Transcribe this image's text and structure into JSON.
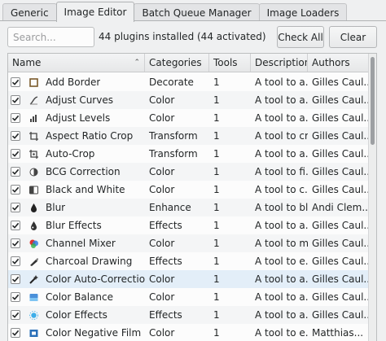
{
  "tabs": [
    {
      "label": "Generic"
    },
    {
      "label": "Image Editor"
    },
    {
      "label": "Batch Queue Manager"
    },
    {
      "label": "Image Loaders"
    }
  ],
  "active_tab": "Image Editor",
  "toolbar": {
    "search_placeholder": "Search...",
    "installed_text": "44 plugins installed (44 activated)",
    "check_all_label": "Check All",
    "clear_label": "Clear"
  },
  "table": {
    "columns": [
      "Name",
      "Categories",
      "Tools",
      "Description",
      "Authors"
    ],
    "sorted_column": "Name",
    "rows": [
      {
        "checked": true,
        "icon": "border-icon",
        "name": "Add Border",
        "category": "Decorate",
        "tools": "1",
        "description": "A tool to a...",
        "authors": "Gilles Caul..."
      },
      {
        "checked": true,
        "icon": "curves-icon",
        "name": "Adjust Curves",
        "category": "Color",
        "tools": "1",
        "description": "A tool to a...",
        "authors": "Gilles Caul..."
      },
      {
        "checked": true,
        "icon": "levels-icon",
        "name": "Adjust Levels",
        "category": "Color",
        "tools": "1",
        "description": "A tool to a...",
        "authors": "Gilles Caul..."
      },
      {
        "checked": true,
        "icon": "ratio-crop-icon",
        "name": "Aspect Ratio Crop",
        "category": "Transform",
        "tools": "1",
        "description": "A tool to cr...",
        "authors": "Gilles Caul..."
      },
      {
        "checked": true,
        "icon": "auto-crop-icon",
        "name": "Auto-Crop",
        "category": "Transform",
        "tools": "1",
        "description": "A tool to a...",
        "authors": "Gilles Caul..."
      },
      {
        "checked": true,
        "icon": "bcg-icon",
        "name": "BCG Correction",
        "category": "Color",
        "tools": "1",
        "description": "A tool to fi...",
        "authors": "Gilles Caul..."
      },
      {
        "checked": true,
        "icon": "black-white-icon",
        "name": "Black and White",
        "category": "Color",
        "tools": "1",
        "description": "A tool to c...",
        "authors": "Gilles Caul..."
      },
      {
        "checked": true,
        "icon": "blur-icon",
        "name": "Blur",
        "category": "Enhance",
        "tools": "1",
        "description": "A tool to bl...",
        "authors": "Andi Clem..."
      },
      {
        "checked": true,
        "icon": "blur-effects-icon",
        "name": "Blur Effects",
        "category": "Effects",
        "tools": "1",
        "description": "A tool to a...",
        "authors": "Gilles Caul..."
      },
      {
        "checked": true,
        "icon": "channel-mixer-icon",
        "name": "Channel Mixer",
        "category": "Color",
        "tools": "1",
        "description": "A tool to m...",
        "authors": "Gilles Caul..."
      },
      {
        "checked": true,
        "icon": "charcoal-icon",
        "name": "Charcoal Drawing",
        "category": "Effects",
        "tools": "1",
        "description": "A tool to e...",
        "authors": "Gilles Caul..."
      },
      {
        "checked": true,
        "icon": "auto-correction-icon",
        "name": "Color Auto-Correction",
        "category": "Color",
        "tools": "1",
        "description": "A tool to a...",
        "authors": "Gilles Caul..."
      },
      {
        "checked": true,
        "icon": "color-balance-icon",
        "name": "Color Balance",
        "category": "Color",
        "tools": "1",
        "description": "A tool to a...",
        "authors": "Gilles Caul..."
      },
      {
        "checked": true,
        "icon": "color-effects-icon",
        "name": "Color Effects",
        "category": "Effects",
        "tools": "1",
        "description": "A tool to a...",
        "authors": "Gilles Caul..."
      },
      {
        "checked": true,
        "icon": "negative-film-icon",
        "name": "Color Negative Film",
        "category": "Color",
        "tools": "1",
        "description": "A tool to e...",
        "authors": "Matthias..."
      }
    ]
  },
  "colors": {
    "accent": "#3daee9",
    "checkmark": "#232627",
    "hover_row": "#e3eef8"
  }
}
